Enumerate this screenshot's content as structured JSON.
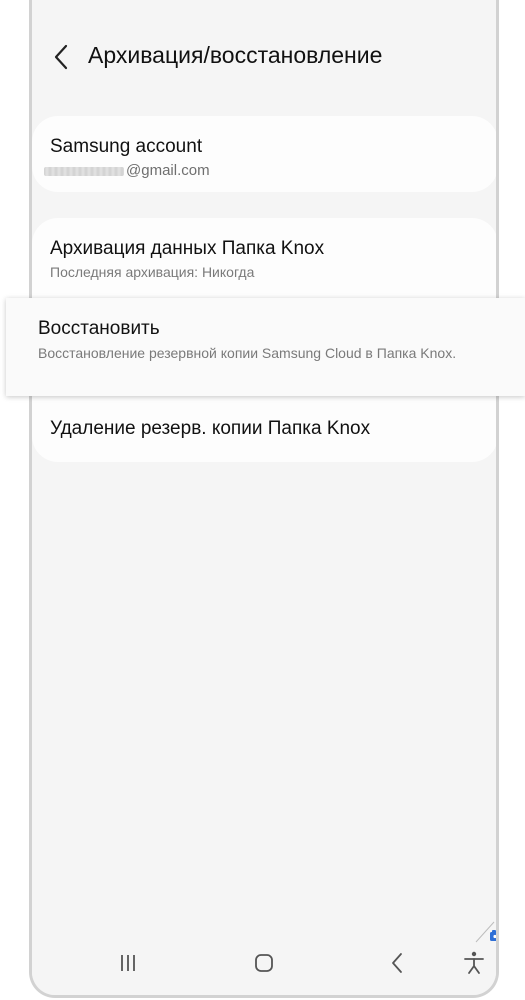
{
  "header": {
    "title": "Архивация/восстановление",
    "back_icon": "chevron-left-icon"
  },
  "account": {
    "title": "Samsung account",
    "email_suffix": "@gmail.com"
  },
  "items": [
    {
      "title": "Архивация данных Папка Knox",
      "subtitle": "Последняя архивация: Никогда"
    },
    {
      "title": "Восстановить",
      "subtitle": "Восстановление резервной копии Samsung Cloud в Папка Knox."
    },
    {
      "title": "Удаление резерв. копии Папка Knox",
      "subtitle": ""
    }
  ],
  "navbar": {
    "recents_icon": "recents-icon",
    "home_icon": "home-icon",
    "back_icon": "back-icon",
    "accessibility_icon": "accessibility-icon"
  },
  "colors": {
    "background": "#f5f5f5",
    "card": "#fdfdfd",
    "text_primary": "#111111",
    "text_secondary": "#7a7a7a",
    "badge_blue": "#2f6fd6"
  }
}
